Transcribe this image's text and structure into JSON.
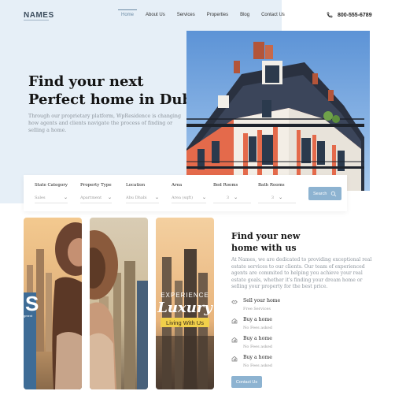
{
  "brand": {
    "logo": "NAMES"
  },
  "nav": {
    "items": [
      {
        "label": "Home",
        "active": true
      },
      {
        "label": "About Us",
        "active": false
      },
      {
        "label": "Services",
        "active": false
      },
      {
        "label": "Properties",
        "active": false
      },
      {
        "label": "Blog",
        "active": false
      },
      {
        "label": "Contact Us",
        "active": false
      }
    ]
  },
  "phone": {
    "icon": "phone-icon",
    "number": "800-555-6789"
  },
  "hero": {
    "title_line1": "Find your next",
    "title_line2": "Perfect home in Dubai",
    "description": "Through our proprietary platform, WpResidence is changing how agents and clients navigate the process of finding or selling a home."
  },
  "search": {
    "fields": [
      {
        "label": "State Category",
        "value": "Sales"
      },
      {
        "label": "Property Type",
        "value": "Apartment"
      },
      {
        "label": "Location",
        "value": "Abu Dhabi"
      },
      {
        "label": "Area",
        "value": "Area (sqft)"
      },
      {
        "label": "Bed Rooms",
        "value": "3"
      },
      {
        "label": "Bath Rooms",
        "value": "3"
      }
    ],
    "button_label": "Search"
  },
  "cards": {
    "card3_line1": "EXPERIENCE",
    "card3_line2": "Luxury",
    "card3_line3": "Living With Us"
  },
  "about": {
    "title_line1": "Find your new",
    "title_line2": "home with us",
    "description": "At Names, we are dedicated to providing exceptional real estate services to our clients. Our team of experienced agents are commited to helping you achieve your real estate goals, whether it's finding your dream home or selling your property for the best price.",
    "features": [
      {
        "icon": "handshake-icon",
        "title": "Sell your home",
        "subtitle": "Free Services"
      },
      {
        "icon": "house-chart-icon",
        "title": "Buy a home",
        "subtitle": "No Fees asked"
      },
      {
        "icon": "house-chart-icon",
        "title": "Buy a home",
        "subtitle": "No Fees asked"
      },
      {
        "icon": "house-chart-icon",
        "title": "Buy a home",
        "subtitle": "No Fees asked"
      }
    ],
    "button_label": "Contact Us"
  },
  "colors": {
    "accent": "#8db3d1",
    "hero_bg": "#e6eff7",
    "nav_active": "#6a8aa4"
  }
}
